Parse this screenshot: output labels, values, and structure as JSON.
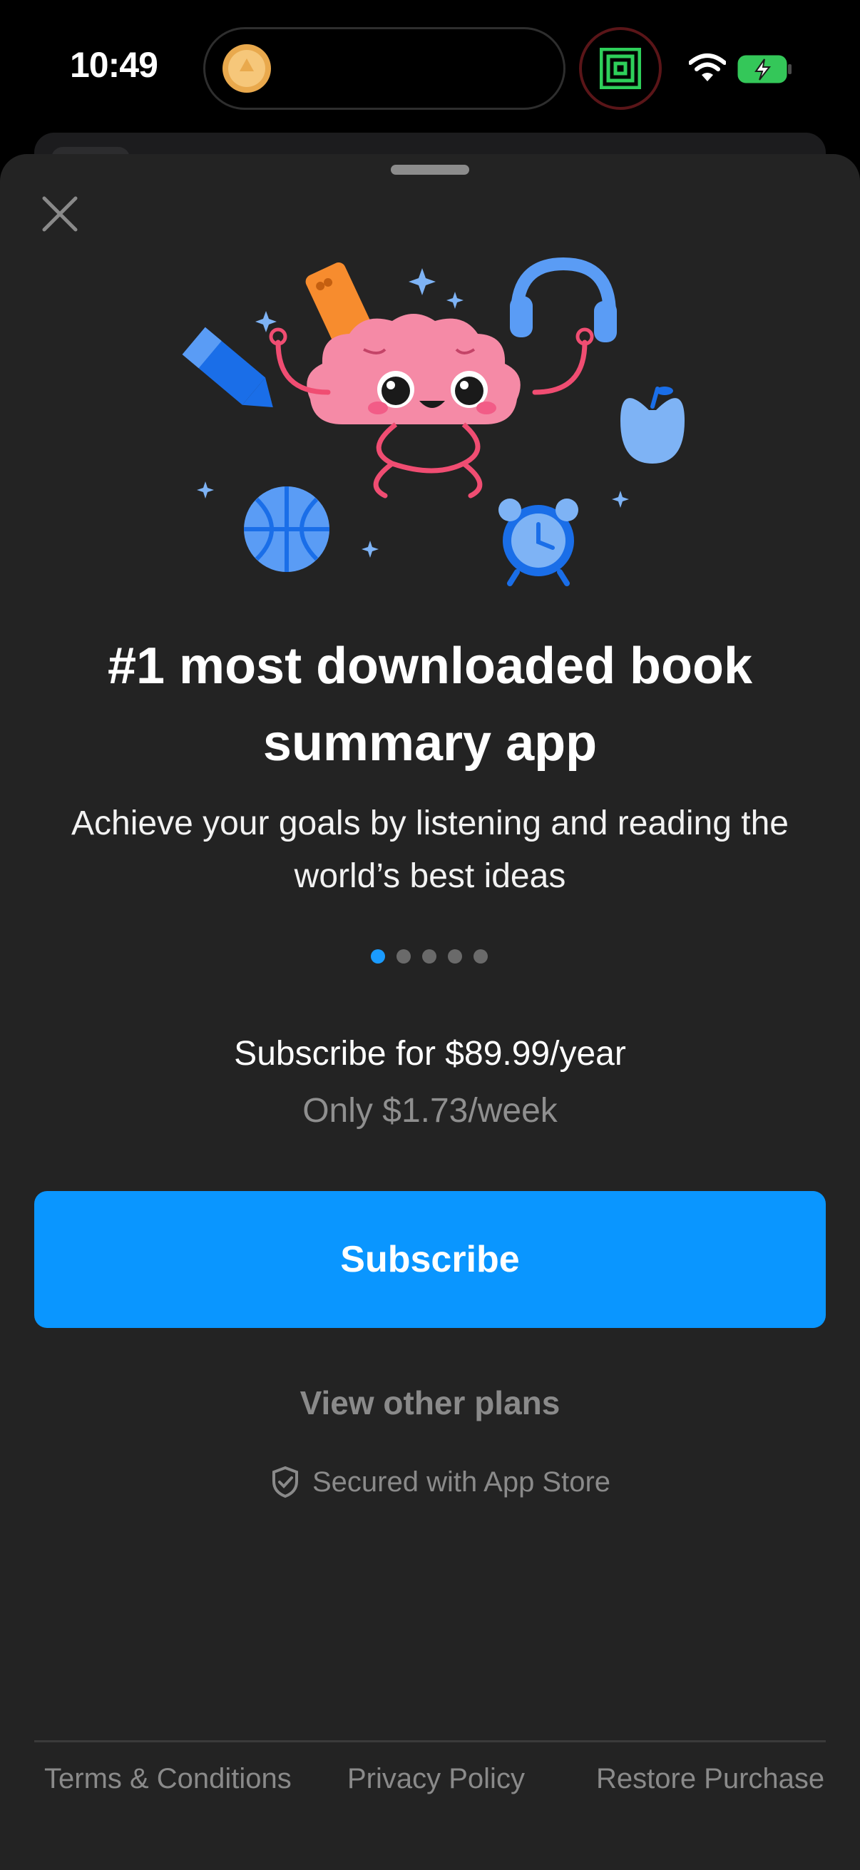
{
  "status_bar": {
    "time": "10:49",
    "icons": [
      "coin-icon",
      "app-maze-icon",
      "wifi-icon",
      "battery-charging-icon"
    ]
  },
  "sheet": {
    "close_icon": "close-icon",
    "illustration": "brain-mascot-illustration",
    "headline": "#1 most downloaded book summary app",
    "subtitle": "Achieve your goals by listening and reading the world’s best ideas",
    "carousel": {
      "total": 5,
      "active_index": 0
    },
    "price_line": "Subscribe for $89.99/year",
    "per_week": "Only $1.73/week",
    "subscribe_label": "Subscribe",
    "other_plans_label": "View other plans",
    "secured_label": "Secured with App Store"
  },
  "footer": {
    "terms": "Terms & Conditions",
    "privacy": "Privacy Policy",
    "restore": "Restore Purchase"
  },
  "colors": {
    "accent": "#0a96ff",
    "sheet_bg": "#232323",
    "muted_text": "#8a8a8a",
    "brain_pink": "#f58aa6",
    "icon_blue": "#1a6ee8"
  }
}
